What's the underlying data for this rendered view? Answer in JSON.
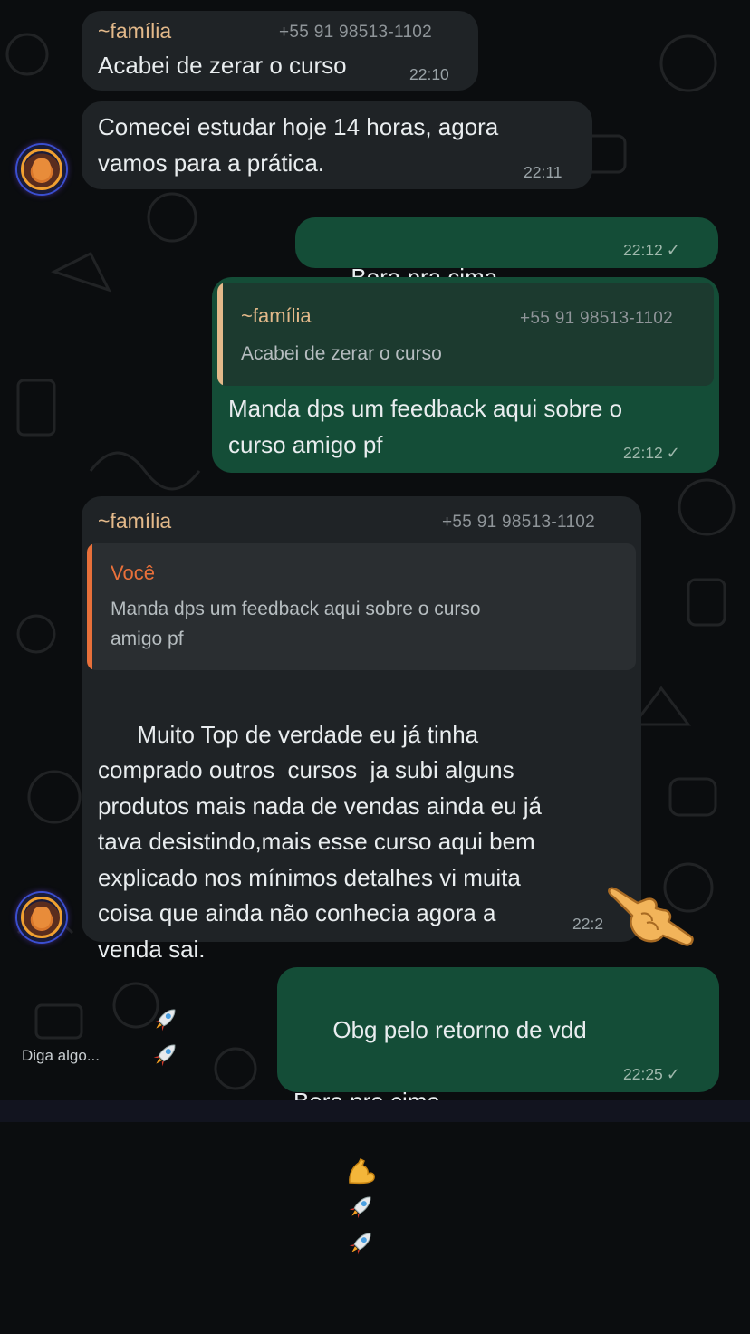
{
  "composer": {
    "placeholder": "Diga algo..."
  },
  "messages": [
    {
      "sender": "~família",
      "phone": "+55 91 98513-1102",
      "text": "Acabei de zerar o curso",
      "time": "22:10"
    },
    {
      "text": "Comecei estudar hoje 14 horas, agora\nvamos para a prática.",
      "time": "22:11"
    },
    {
      "text": "Bora pra cima",
      "emojis": [
        "flexed-biceps",
        "rocket",
        "rocket"
      ],
      "time": "22:12",
      "status": "✓"
    },
    {
      "quote": {
        "sender": "~família",
        "phone": "+55 91 98513-1102",
        "text": "Acabei de zerar o curso"
      },
      "text": "Manda dps um feedback aqui sobre o\ncurso amigo pf",
      "time": "22:12",
      "status": "✓"
    },
    {
      "sender": "~família",
      "phone": "+55 91 98513-1102",
      "quote": {
        "sender": "Você",
        "text": "Manda dps um feedback aqui sobre o curso\namigo pf"
      },
      "text": "Muito Top de verdade eu já tinha\ncomprado outros  cursos  ja subi alguns\nprodutos mais nada de vendas ainda eu já\ntava desistindo,mais esse curso aqui bem\nexplicado nos mínimos detalhes vi muita\ncoisa que ainda não conhecia agora a\nvenda sai.",
      "emojis": [
        "rocket",
        "rocket"
      ],
      "time": "22:2"
    },
    {
      "text": "Obg pelo retorno de vdd\n\nBora pra cima",
      "emojis": [
        "flexed-biceps",
        "rocket",
        "rocket"
      ],
      "time": "22:25",
      "status": "✓"
    }
  ],
  "overlay": {
    "sticker": "pointing-hand-icon"
  },
  "colors": {
    "incoming_bubble": "#1f2326",
    "outgoing_bubble": "#144d37",
    "sender_name": "#e3b98a",
    "quote_you": "#e8703a",
    "background": "#0b0d0f"
  }
}
